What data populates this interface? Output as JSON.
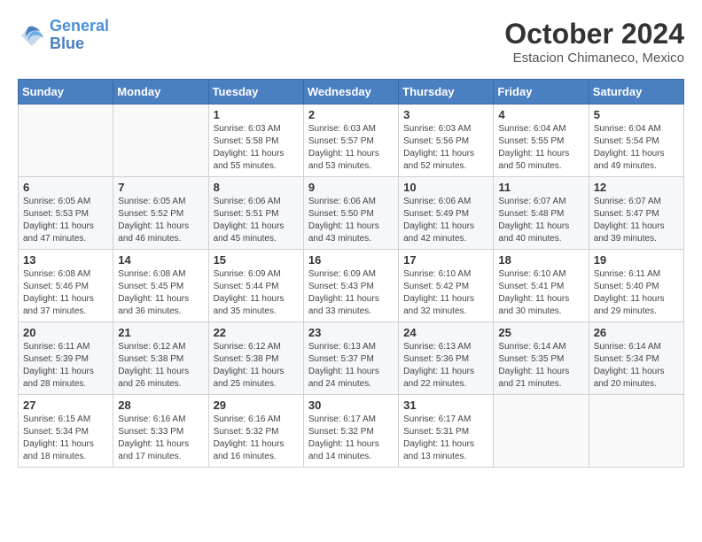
{
  "logo": {
    "line1": "General",
    "line2": "Blue"
  },
  "title": "October 2024",
  "subtitle": "Estacion Chimaneco, Mexico",
  "weekdays": [
    "Sunday",
    "Monday",
    "Tuesday",
    "Wednesday",
    "Thursday",
    "Friday",
    "Saturday"
  ],
  "weeks": [
    [
      {
        "day": "",
        "info": ""
      },
      {
        "day": "",
        "info": ""
      },
      {
        "day": "1",
        "info": "Sunrise: 6:03 AM\nSunset: 5:58 PM\nDaylight: 11 hours and 55 minutes."
      },
      {
        "day": "2",
        "info": "Sunrise: 6:03 AM\nSunset: 5:57 PM\nDaylight: 11 hours and 53 minutes."
      },
      {
        "day": "3",
        "info": "Sunrise: 6:03 AM\nSunset: 5:56 PM\nDaylight: 11 hours and 52 minutes."
      },
      {
        "day": "4",
        "info": "Sunrise: 6:04 AM\nSunset: 5:55 PM\nDaylight: 11 hours and 50 minutes."
      },
      {
        "day": "5",
        "info": "Sunrise: 6:04 AM\nSunset: 5:54 PM\nDaylight: 11 hours and 49 minutes."
      }
    ],
    [
      {
        "day": "6",
        "info": "Sunrise: 6:05 AM\nSunset: 5:53 PM\nDaylight: 11 hours and 47 minutes."
      },
      {
        "day": "7",
        "info": "Sunrise: 6:05 AM\nSunset: 5:52 PM\nDaylight: 11 hours and 46 minutes."
      },
      {
        "day": "8",
        "info": "Sunrise: 6:06 AM\nSunset: 5:51 PM\nDaylight: 11 hours and 45 minutes."
      },
      {
        "day": "9",
        "info": "Sunrise: 6:06 AM\nSunset: 5:50 PM\nDaylight: 11 hours and 43 minutes."
      },
      {
        "day": "10",
        "info": "Sunrise: 6:06 AM\nSunset: 5:49 PM\nDaylight: 11 hours and 42 minutes."
      },
      {
        "day": "11",
        "info": "Sunrise: 6:07 AM\nSunset: 5:48 PM\nDaylight: 11 hours and 40 minutes."
      },
      {
        "day": "12",
        "info": "Sunrise: 6:07 AM\nSunset: 5:47 PM\nDaylight: 11 hours and 39 minutes."
      }
    ],
    [
      {
        "day": "13",
        "info": "Sunrise: 6:08 AM\nSunset: 5:46 PM\nDaylight: 11 hours and 37 minutes."
      },
      {
        "day": "14",
        "info": "Sunrise: 6:08 AM\nSunset: 5:45 PM\nDaylight: 11 hours and 36 minutes."
      },
      {
        "day": "15",
        "info": "Sunrise: 6:09 AM\nSunset: 5:44 PM\nDaylight: 11 hours and 35 minutes."
      },
      {
        "day": "16",
        "info": "Sunrise: 6:09 AM\nSunset: 5:43 PM\nDaylight: 11 hours and 33 minutes."
      },
      {
        "day": "17",
        "info": "Sunrise: 6:10 AM\nSunset: 5:42 PM\nDaylight: 11 hours and 32 minutes."
      },
      {
        "day": "18",
        "info": "Sunrise: 6:10 AM\nSunset: 5:41 PM\nDaylight: 11 hours and 30 minutes."
      },
      {
        "day": "19",
        "info": "Sunrise: 6:11 AM\nSunset: 5:40 PM\nDaylight: 11 hours and 29 minutes."
      }
    ],
    [
      {
        "day": "20",
        "info": "Sunrise: 6:11 AM\nSunset: 5:39 PM\nDaylight: 11 hours and 28 minutes."
      },
      {
        "day": "21",
        "info": "Sunrise: 6:12 AM\nSunset: 5:38 PM\nDaylight: 11 hours and 26 minutes."
      },
      {
        "day": "22",
        "info": "Sunrise: 6:12 AM\nSunset: 5:38 PM\nDaylight: 11 hours and 25 minutes."
      },
      {
        "day": "23",
        "info": "Sunrise: 6:13 AM\nSunset: 5:37 PM\nDaylight: 11 hours and 24 minutes."
      },
      {
        "day": "24",
        "info": "Sunrise: 6:13 AM\nSunset: 5:36 PM\nDaylight: 11 hours and 22 minutes."
      },
      {
        "day": "25",
        "info": "Sunrise: 6:14 AM\nSunset: 5:35 PM\nDaylight: 11 hours and 21 minutes."
      },
      {
        "day": "26",
        "info": "Sunrise: 6:14 AM\nSunset: 5:34 PM\nDaylight: 11 hours and 20 minutes."
      }
    ],
    [
      {
        "day": "27",
        "info": "Sunrise: 6:15 AM\nSunset: 5:34 PM\nDaylight: 11 hours and 18 minutes."
      },
      {
        "day": "28",
        "info": "Sunrise: 6:16 AM\nSunset: 5:33 PM\nDaylight: 11 hours and 17 minutes."
      },
      {
        "day": "29",
        "info": "Sunrise: 6:16 AM\nSunset: 5:32 PM\nDaylight: 11 hours and 16 minutes."
      },
      {
        "day": "30",
        "info": "Sunrise: 6:17 AM\nSunset: 5:32 PM\nDaylight: 11 hours and 14 minutes."
      },
      {
        "day": "31",
        "info": "Sunrise: 6:17 AM\nSunset: 5:31 PM\nDaylight: 11 hours and 13 minutes."
      },
      {
        "day": "",
        "info": ""
      },
      {
        "day": "",
        "info": ""
      }
    ]
  ]
}
